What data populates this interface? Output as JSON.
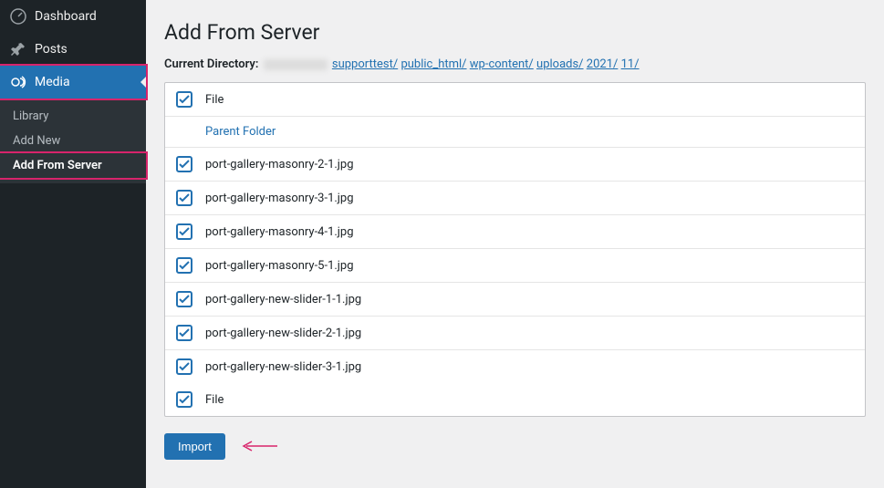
{
  "sidebar": {
    "items": [
      {
        "label": "Dashboard"
      },
      {
        "label": "Posts"
      },
      {
        "label": "Media"
      }
    ],
    "submenu": [
      {
        "label": "Library"
      },
      {
        "label": "Add New"
      },
      {
        "label": "Add From Server"
      }
    ]
  },
  "page": {
    "title": "Add From Server",
    "current_dir_label": "Current Directory:",
    "breadcrumbs": [
      "supporttest/",
      "public_html/",
      "wp-content/",
      "uploads/",
      "2021/",
      "11/"
    ],
    "import_label": "Import"
  },
  "table": {
    "header_label": "File",
    "footer_label": "File",
    "parent_label": "Parent Folder",
    "files": [
      "port-gallery-masonry-2-1.jpg",
      "port-gallery-masonry-3-1.jpg",
      "port-gallery-masonry-4-1.jpg",
      "port-gallery-masonry-5-1.jpg",
      "port-gallery-new-slider-1-1.jpg",
      "port-gallery-new-slider-2-1.jpg",
      "port-gallery-new-slider-3-1.jpg"
    ]
  }
}
